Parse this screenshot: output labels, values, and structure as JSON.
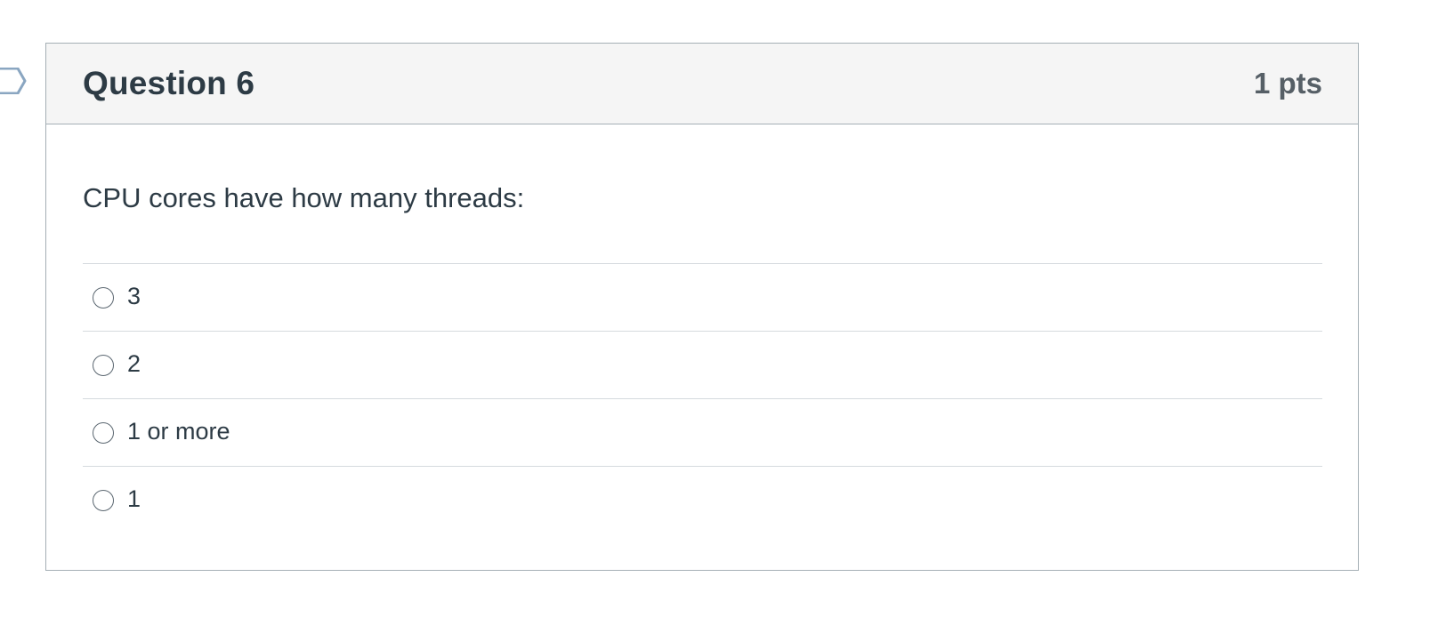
{
  "question": {
    "title": "Question 6",
    "points": "1 pts",
    "text": "CPU cores have how many threads:",
    "answers": [
      {
        "label": "3",
        "selected": false
      },
      {
        "label": "2",
        "selected": false
      },
      {
        "label": "1 or more",
        "selected": false
      },
      {
        "label": "1",
        "selected": false
      }
    ]
  },
  "colors": {
    "header_background": "#f5f5f5",
    "border": "#a5afb5",
    "divider": "#d5dade",
    "text": "#2d3b45",
    "points_text": "#565f66",
    "flag_outline": "#8aa6c1"
  },
  "icons": {
    "flag": "flag-bookmark-icon",
    "radio": "radio-unchecked-icon"
  }
}
